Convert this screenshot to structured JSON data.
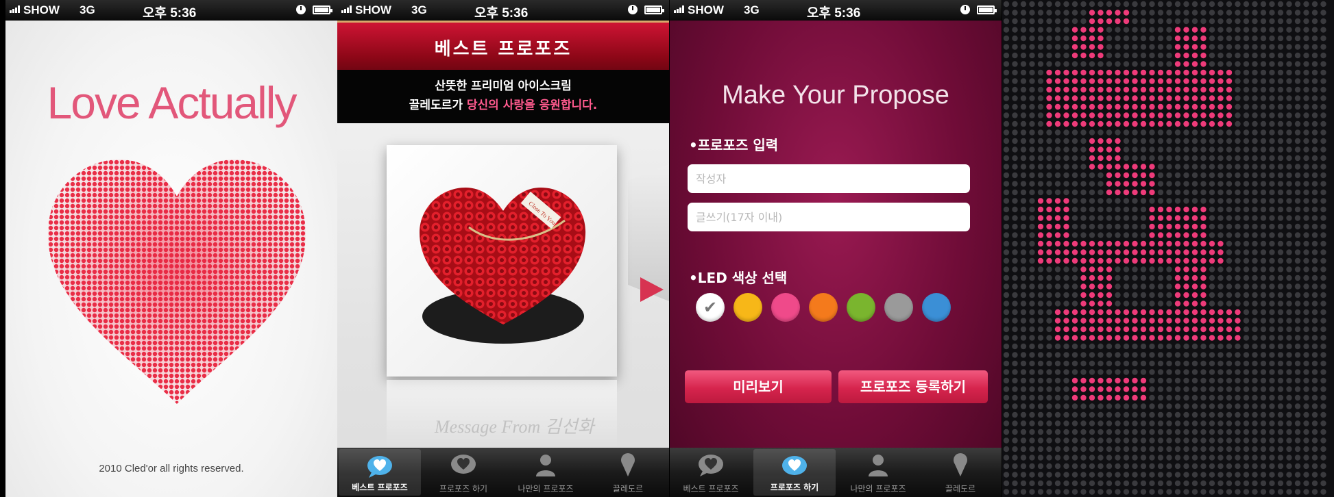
{
  "status_bar": {
    "carrier": "SHOW",
    "network": "3G",
    "time": "오후 5:36"
  },
  "splash": {
    "title": "Love Actually",
    "copyright": "2010 Cled'or all rights reserved."
  },
  "best": {
    "header_title": "베스트 프로포즈",
    "banner_line1": "산뜻한 프리미엄 아이스크림",
    "banner_line2_prefix": "끌레도르가 ",
    "banner_line2_highlight": "당신의 사랑을 응원합니다.",
    "image_tag": "Close To You",
    "reflection_text": "Message From 김선화"
  },
  "tabs": [
    {
      "label": "베스트 프로포즈",
      "icon": "speech-heart-icon"
    },
    {
      "label": "프로포즈 하기",
      "icon": "heart-bubble-icon"
    },
    {
      "label": "나만의 프로포즈",
      "icon": "person-icon"
    },
    {
      "label": "끌레도르",
      "icon": "ice-cream-icon"
    }
  ],
  "make": {
    "title": "Make Your Propose",
    "input_section_label": "•프로포즈 입력",
    "author_placeholder": "작성자",
    "message_placeholder": "글쓰기(17자 이내)",
    "color_section_label": "•LED 색상 선택",
    "colors": [
      "#ffffff",
      "#f7b718",
      "#ef4a8a",
      "#f47a1c",
      "#7ab52e",
      "#9a9a9a",
      "#3b8fd6"
    ],
    "preview_button": "미리보기",
    "register_button": "프로포즈 등록하기"
  },
  "led": {
    "lit_color": "#ee3b7a",
    "off_color": "#3a3a3e"
  }
}
